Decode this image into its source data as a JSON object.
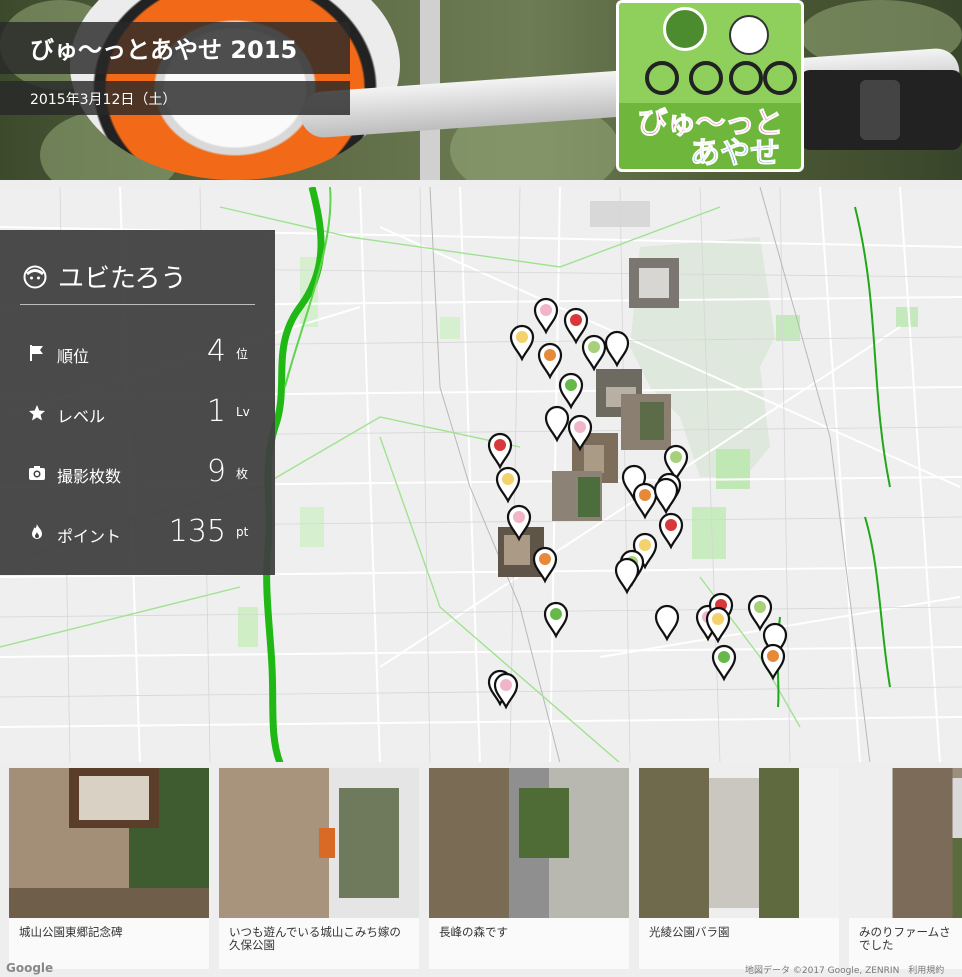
{
  "event": {
    "title": "びゅ〜っとあやせ 2015",
    "date": "2015年3月12日（土）"
  },
  "hero": {
    "plate_text_line1": "びゅ〜っと",
    "plate_text_line2": "あやせ"
  },
  "user": {
    "name": "ユビたろう",
    "icon": "user-face-icon"
  },
  "stats": [
    {
      "key": "rank",
      "icon": "flag-icon",
      "label": "順位",
      "value": "4",
      "unit": "位"
    },
    {
      "key": "level",
      "icon": "star-icon",
      "label": "レベル",
      "value": "1",
      "unit": "Lv"
    },
    {
      "key": "photos",
      "icon": "camera-icon",
      "label": "撮影枚数",
      "value": "9",
      "unit": "枚"
    },
    {
      "key": "points",
      "icon": "flame-icon",
      "label": "ポイント",
      "value": "135",
      "unit": "pt"
    }
  ],
  "photos": [
    {
      "caption": "城山公園東郷記念碑"
    },
    {
      "caption": "いつも遊んでいる城山こみち嫁の久保公園"
    },
    {
      "caption": "長峰の森です"
    },
    {
      "caption": "光綾公園バラ園"
    },
    {
      "caption": "みのりファームさでした"
    }
  ],
  "map": {
    "attribution": "地図データ ©2017 Google, ZENRIN　利用規約",
    "logo": "Google"
  },
  "colors": {
    "panel_bg": "#404040",
    "map_bg": "#efefef",
    "river_green": "#1fb814",
    "pin_fill": "#ffffff"
  }
}
